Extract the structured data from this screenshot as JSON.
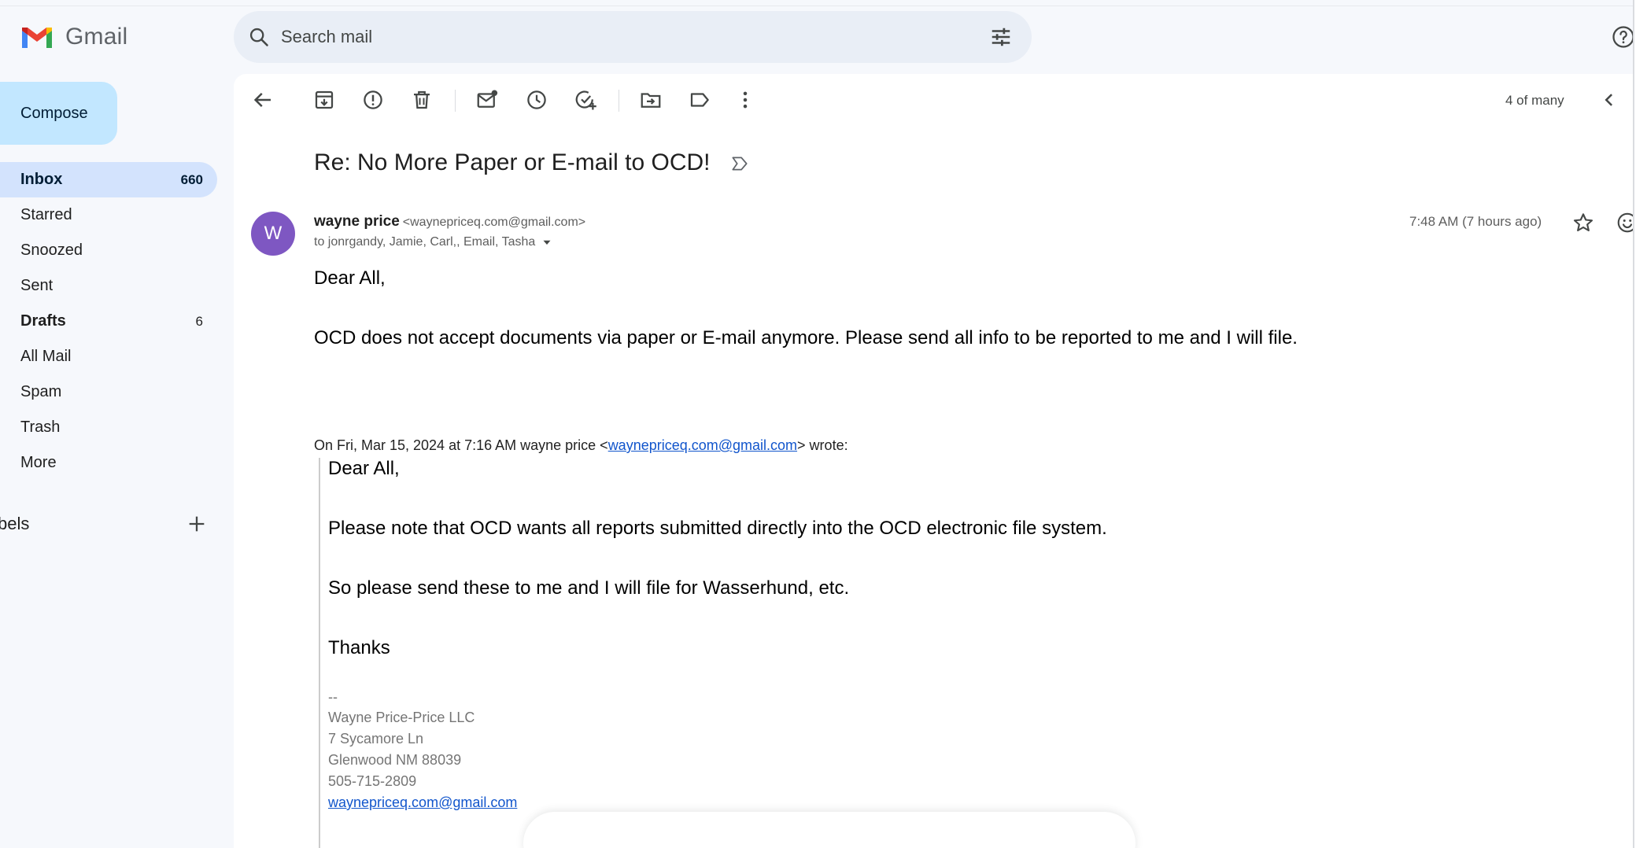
{
  "app": {
    "name": "Gmail"
  },
  "search": {
    "placeholder": "Search mail"
  },
  "sidebar": {
    "compose_label": "Compose",
    "items": [
      {
        "label": "Inbox",
        "count": "660"
      },
      {
        "label": "Starred",
        "count": ""
      },
      {
        "label": "Snoozed",
        "count": ""
      },
      {
        "label": "Sent",
        "count": ""
      },
      {
        "label": "Drafts",
        "count": "6"
      },
      {
        "label": "All Mail",
        "count": ""
      },
      {
        "label": "Spam",
        "count": ""
      },
      {
        "label": "Trash",
        "count": ""
      },
      {
        "label": "More",
        "count": ""
      }
    ],
    "labels_title": "bels"
  },
  "toolbar": {
    "icons": [
      "back-arrow-icon",
      "archive-icon",
      "report-spam-icon",
      "delete-icon",
      "mark-unread-icon",
      "snooze-icon",
      "add-to-tasks-icon",
      "move-to-icon",
      "label-icon",
      "more-vert-icon"
    ],
    "pager": "4 of many"
  },
  "email": {
    "subject": "Re: No More Paper or E-mail to OCD!",
    "avatar_letter": "W",
    "avatar_color": "#7e57c2",
    "sender_name": "wayne price",
    "sender_email": "<waynepriceq.com@gmail.com>",
    "recipients": "to jonrgandy, Jamie, Carl,, Email, Tasha",
    "timestamp": "7:48 AM (7 hours ago)",
    "body": [
      "Dear All,",
      "OCD does not accept documents via paper or E-mail anymore.  Please send all info to be reported to me and I will file."
    ],
    "quote_intro_prefix": "On Fri, Mar 15, 2024 at 7:16 AM wayne price <",
    "quote_intro_link": "waynepriceq.com@gmail.com",
    "quote_intro_suffix": "> wrote:",
    "quoted_body": [
      "Dear All,",
      "Please note that OCD wants all reports submitted directly into the OCD electronic file system.",
      "So please send these to me and I will file for Wasserhund, etc.",
      "Thanks"
    ],
    "signature": [
      "--",
      "Wayne Price-Price LLC",
      "7 Sycamore Ln",
      "Glenwood NM 88039",
      "505-715-2809"
    ],
    "signature_link": "waynepriceq.com@gmail.com"
  },
  "colors": {
    "accent": "#c2e7ff",
    "active_nav": "#d3e3fd",
    "link": "#1155cc",
    "search_bg": "#e9eef6"
  }
}
